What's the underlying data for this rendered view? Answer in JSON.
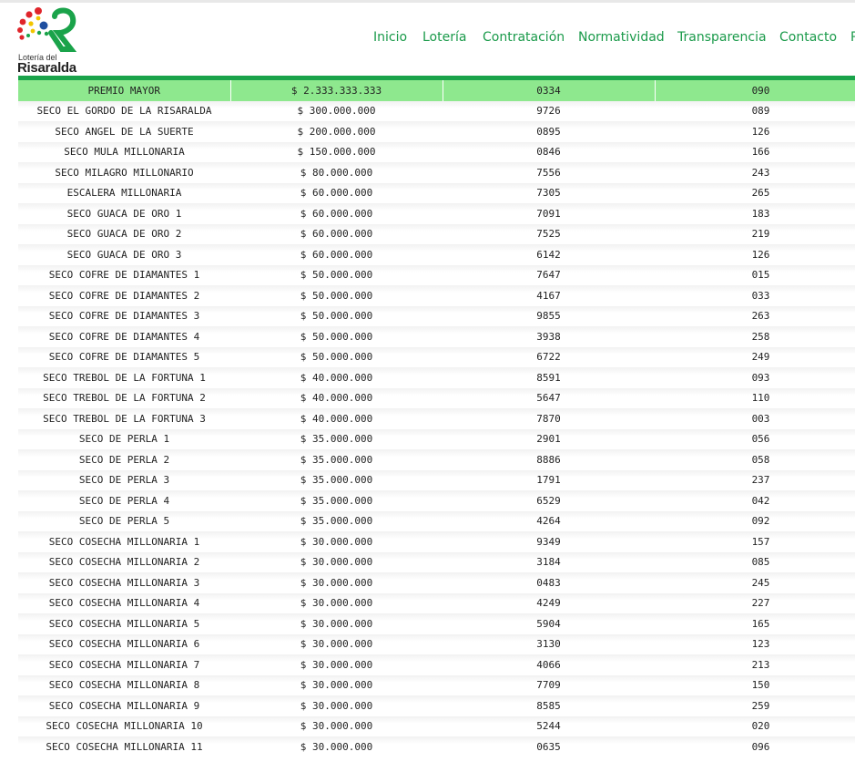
{
  "brand": {
    "line1": "Lotería del",
    "line2": "Risaralda",
    "colors": {
      "green": "#1aa34a",
      "red": "#e0252b",
      "blue": "#1f4fa0",
      "yellow": "#f2c500",
      "highlight": "#8ee88e"
    }
  },
  "nav": {
    "items": [
      {
        "label": "Inicio"
      },
      {
        "label": "Lotería"
      },
      {
        "label": "Contratación"
      },
      {
        "label": "Normatividad"
      },
      {
        "label": "Transparencia"
      },
      {
        "label": "Contacto"
      },
      {
        "label": "P"
      }
    ]
  },
  "results": {
    "rows": [
      {
        "prize": "PREMIO MAYOR",
        "amount": "$ 2.333.333.333",
        "number": "0334",
        "series": "090"
      },
      {
        "prize": "SECO EL GORDO DE LA RISARALDA",
        "amount": "$ 300.000.000",
        "number": "9726",
        "series": "089"
      },
      {
        "prize": "SECO ANGEL DE LA SUERTE",
        "amount": "$ 200.000.000",
        "number": "0895",
        "series": "126"
      },
      {
        "prize": "SECO MULA MILLONARIA",
        "amount": "$ 150.000.000",
        "number": "0846",
        "series": "166"
      },
      {
        "prize": "SECO MILAGRO MILLONARIO",
        "amount": "$ 80.000.000",
        "number": "7556",
        "series": "243"
      },
      {
        "prize": "ESCALERA MILLONARIA",
        "amount": "$ 60.000.000",
        "number": "7305",
        "series": "265"
      },
      {
        "prize": "SECO GUACA DE ORO 1",
        "amount": "$ 60.000.000",
        "number": "7091",
        "series": "183"
      },
      {
        "prize": "SECO GUACA DE ORO 2",
        "amount": "$ 60.000.000",
        "number": "7525",
        "series": "219"
      },
      {
        "prize": "SECO GUACA DE ORO 3",
        "amount": "$ 60.000.000",
        "number": "6142",
        "series": "126"
      },
      {
        "prize": "SECO COFRE DE DIAMANTES 1",
        "amount": "$ 50.000.000",
        "number": "7647",
        "series": "015"
      },
      {
        "prize": "SECO COFRE DE DIAMANTES 2",
        "amount": "$ 50.000.000",
        "number": "4167",
        "series": "033"
      },
      {
        "prize": "SECO COFRE DE DIAMANTES 3",
        "amount": "$ 50.000.000",
        "number": "9855",
        "series": "263"
      },
      {
        "prize": "SECO COFRE DE DIAMANTES 4",
        "amount": "$ 50.000.000",
        "number": "3938",
        "series": "258"
      },
      {
        "prize": "SECO COFRE DE DIAMANTES 5",
        "amount": "$ 50.000.000",
        "number": "6722",
        "series": "249"
      },
      {
        "prize": "SECO TREBOL DE LA FORTUNA 1",
        "amount": "$ 40.000.000",
        "number": "8591",
        "series": "093"
      },
      {
        "prize": "SECO TREBOL DE LA FORTUNA 2",
        "amount": "$ 40.000.000",
        "number": "5647",
        "series": "110"
      },
      {
        "prize": "SECO TREBOL DE LA FORTUNA 3",
        "amount": "$ 40.000.000",
        "number": "7870",
        "series": "003"
      },
      {
        "prize": "SECO DE PERLA 1",
        "amount": "$ 35.000.000",
        "number": "2901",
        "series": "056"
      },
      {
        "prize": "SECO DE PERLA 2",
        "amount": "$ 35.000.000",
        "number": "8886",
        "series": "058"
      },
      {
        "prize": "SECO DE PERLA 3",
        "amount": "$ 35.000.000",
        "number": "1791",
        "series": "237"
      },
      {
        "prize": "SECO DE PERLA 4",
        "amount": "$ 35.000.000",
        "number": "6529",
        "series": "042"
      },
      {
        "prize": "SECO DE PERLA 5",
        "amount": "$ 35.000.000",
        "number": "4264",
        "series": "092"
      },
      {
        "prize": "SECO COSECHA MILLONARIA 1",
        "amount": "$ 30.000.000",
        "number": "9349",
        "series": "157"
      },
      {
        "prize": "SECO COSECHA MILLONARIA 2",
        "amount": "$ 30.000.000",
        "number": "3184",
        "series": "085"
      },
      {
        "prize": "SECO COSECHA MILLONARIA 3",
        "amount": "$ 30.000.000",
        "number": "0483",
        "series": "245"
      },
      {
        "prize": "SECO COSECHA MILLONARIA 4",
        "amount": "$ 30.000.000",
        "number": "4249",
        "series": "227"
      },
      {
        "prize": "SECO COSECHA MILLONARIA 5",
        "amount": "$ 30.000.000",
        "number": "5904",
        "series": "165"
      },
      {
        "prize": "SECO COSECHA MILLONARIA 6",
        "amount": "$ 30.000.000",
        "number": "3130",
        "series": "123"
      },
      {
        "prize": "SECO COSECHA MILLONARIA 7",
        "amount": "$ 30.000.000",
        "number": "4066",
        "series": "213"
      },
      {
        "prize": "SECO COSECHA MILLONARIA 8",
        "amount": "$ 30.000.000",
        "number": "7709",
        "series": "150"
      },
      {
        "prize": "SECO COSECHA MILLONARIA 9",
        "amount": "$ 30.000.000",
        "number": "8585",
        "series": "259"
      },
      {
        "prize": "SECO COSECHA MILLONARIA 10",
        "amount": "$ 30.000.000",
        "number": "5244",
        "series": "020"
      },
      {
        "prize": "SECO COSECHA MILLONARIA 11",
        "amount": "$ 30.000.000",
        "number": "0635",
        "series": "096"
      }
    ]
  }
}
